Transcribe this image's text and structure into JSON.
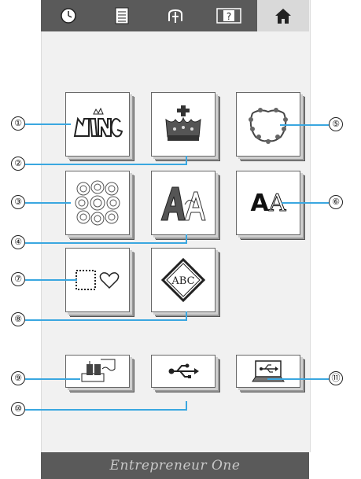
{
  "footer": {
    "brand": "Entrepreneur One"
  },
  "callouts": {
    "n1": "①",
    "n2": "②",
    "n3": "③",
    "n4": "④",
    "n5": "⑤",
    "n6": "⑥",
    "n7": "⑦",
    "n8": "⑧",
    "n9": "⑨",
    "n10": "⑩",
    "n11": "⑪"
  },
  "buttons": {
    "font_aa": {
      "left": "A",
      "right": "A"
    },
    "monogram": "ABC"
  },
  "colors": {
    "leader": "#3aa7e0",
    "bar": "#5a5a5a"
  }
}
